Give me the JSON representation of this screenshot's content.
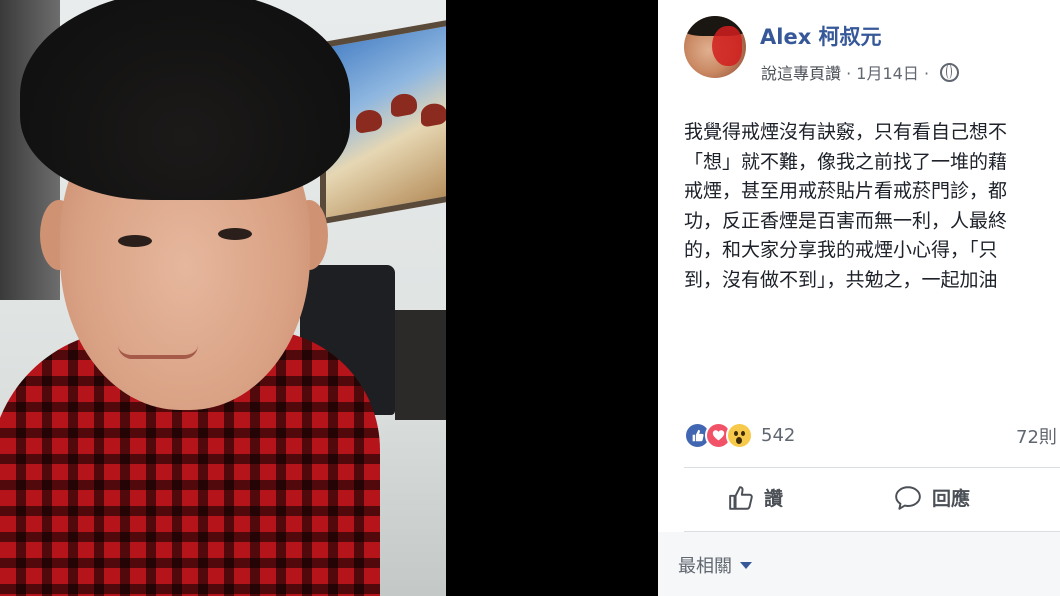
{
  "post": {
    "author_name": "Alex 柯叔元",
    "meta": {
      "posted_by": "說這專頁讚",
      "separator": "·",
      "date": "1月14日",
      "separator2": "·"
    },
    "body_lines": [
      "我覺得戒煙沒有訣竅，只有看自己想不",
      "「想」就不難，像我之前找了一堆的藉",
      "戒煙，甚至用戒菸貼片看戒菸門診，都",
      "功，反正香煙是百害而無一利，人最終",
      "的，和大家分享我的戒煙小心得，「只",
      "到，沒有做不到」，共勉之，一起加油"
    ],
    "reactions": {
      "icons": [
        "like-icon",
        "love-icon",
        "wow-icon"
      ],
      "count": "542"
    },
    "comments_count": "72則",
    "actions": {
      "like_label": "讚",
      "comment_label": "回應"
    },
    "sort_label": "最相關"
  },
  "colors": {
    "brand_link": "#365899",
    "text_secondary": "#616770",
    "like": "#4267b2",
    "love": "#f25268",
    "wow": "#f7c94b"
  }
}
